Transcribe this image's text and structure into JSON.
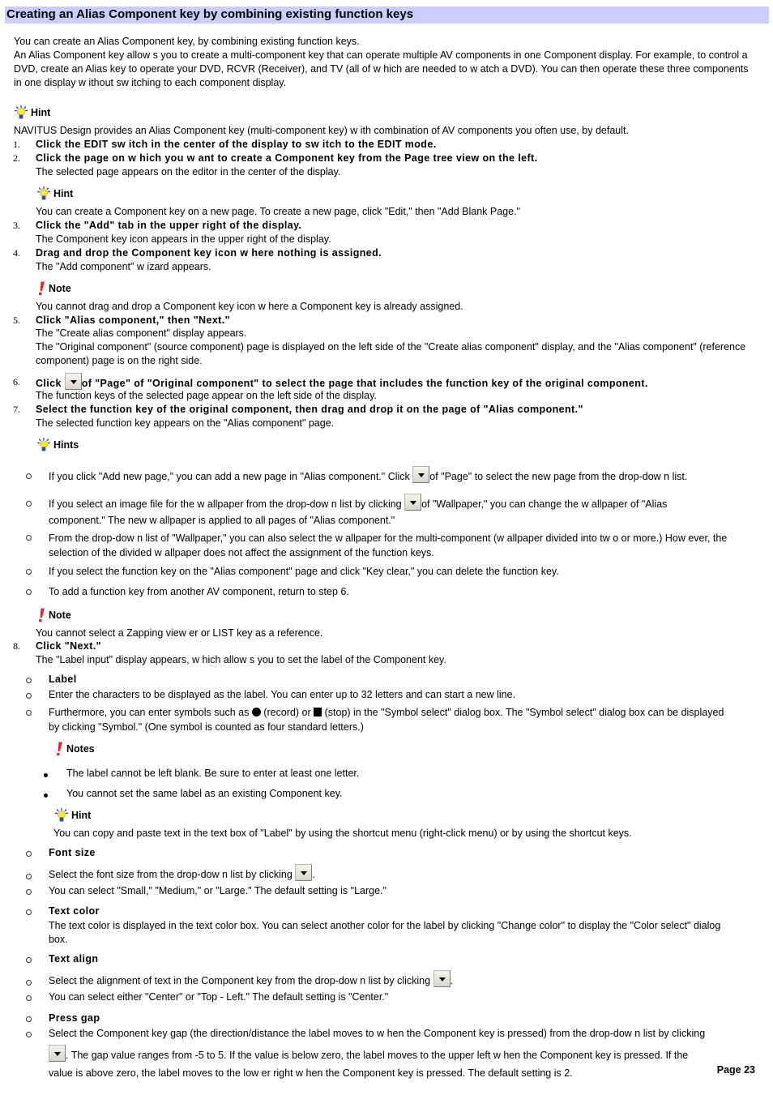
{
  "title": "Creating an Alias Component key by combining existing function keys",
  "intro": [
    "You can create an Alias Component key, by combining existing function keys.",
    "An Alias Component key allow s you to create a multi-component key that can operate multiple AV components in one Component display. For example, to control a DVD, create an Alias key to operate your DVD, RCVR (Receiver), and TV (all of w hich are needed to w atch a DVD). You can then operate these three components in one display w ithout sw itching to each component display."
  ],
  "hint1": {
    "label": "Hint",
    "text": "NAVITUS Design provides an Alias Component key (multi-component key) w ith combination of AV components you often use, by default."
  },
  "steps": [
    {
      "num": "1.",
      "title": "Click the EDIT sw itch in the center of the display to sw itch to the EDIT mode."
    },
    {
      "num": "2.",
      "title": "Click the page on w hich you w ant to create a Component key from the Page tree view on the left.",
      "desc": "The selected page appears on the editor in the center of the display."
    },
    {
      "num": "3.",
      "title": "Click the \"Add\" tab in the upper right of the display.",
      "desc": "The Component key icon appears in the upper right of the display."
    },
    {
      "num": "4.",
      "title": "Drag and drop the Component key icon w here nothing is assigned.",
      "desc": "The \"Add component\" w izard appears."
    },
    {
      "num": "5.",
      "title": "Click \"Alias component,\" then \"Next.\"",
      "desc": "The \"Create alias component\" display appears.",
      "desc2": "The \"Original component\" (source component) page is displayed on the left side of the \"Create alias component\" display, and the \"Alias component\" (reference component) page is on the right side."
    },
    {
      "num": "6.",
      "title_pre": "Click ",
      "title_post": "of \"Page\" of \"Original component\" to select the page that includes the function key of the original component.",
      "desc": "The function keys of the selected page appear on the left side of the display."
    },
    {
      "num": "7.",
      "title": "Select the function key of the original component, then drag and drop it on the page of \"Alias component.\"",
      "desc": "The selected function key appears on the \"Alias component\" page."
    },
    {
      "num": "8.",
      "title": "Click \"Next.\"",
      "desc": "The \"Label input\" display appears, w hich allow s you to set the label of the Component key."
    }
  ],
  "hint2": {
    "label": "Hint",
    "text": "You can create a Component key on a new  page. To create a new  page, click \"Edit,\" then \"Add Blank Page.\""
  },
  "note1": {
    "label": "Note",
    "text": "You cannot drag and drop a Component key icon w here a Component key is already assigned."
  },
  "hints3": {
    "label": "Hints",
    "items": [
      {
        "pre": "If you click \"Add new  page,\" you can add a new  page in \"Alias component.\" Click ",
        "post": "of \"Page\" to select the new  page from the drop-dow n list."
      },
      {
        "pre": "If you select an image file for the w allpaper from the drop-dow n list by clicking ",
        "post": "of \"Wallpaper,\" you can change the w allpaper of \"Alias component.\" The new  w allpaper is applied to all pages of \"Alias component.\""
      },
      {
        "text": "From the drop-dow n list of \"Wallpaper,\" you can also select the w allpaper for the multi-component (w allpaper divided into tw o or more.) How ever, the selection of the divided w allpaper does not affect the assignment of the function keys."
      },
      {
        "text": "If you select the function key on the \"Alias component\" page and click \"Key clear,\" you can delete the function key."
      },
      {
        "text": "To add a function key from another AV component, return to step 6."
      }
    ]
  },
  "note2": {
    "label": "Note",
    "text": "You cannot select a Zapping view er or LIST key as a reference."
  },
  "label_section": {
    "heading": "Label",
    "line1": "Enter the characters to be displayed as the label. You can enter up to 32 letters and can start a new  line.",
    "line2_a": "Furthermore, you can enter symbols such as ",
    "line2_b": "(record) or ",
    "line2_c": "(stop) in the \"Symbol select\" dialog box. The \"Symbol select\" dialog box can be displayed by clicking \"Symbol.\" (One symbol is counted as four standard letters.)",
    "notes_label": "Notes",
    "notes": [
      "The label cannot be left blank. Be sure to enter at least one letter.",
      "You cannot set the same label as an existing Component key."
    ],
    "hint_label": "Hint",
    "hint_text": "You can copy and paste text in the text box of \"Label\" by using the shortcut menu (right-click menu) or by using the shortcut keys."
  },
  "font_size": {
    "heading": "Font size",
    "line1_pre": "Select the font size from the drop-dow n list by clicking ",
    "line1_post": ".",
    "line2": "You can select \"Small,\" \"Medium,\" or \"Large.\" The default setting is \"Large.\""
  },
  "text_color": {
    "heading": "Text color",
    "text": "The text color is displayed in the text color box. You can select another color for the label by clicking \"Change color\" to display the \"Color select\" dialog box."
  },
  "text_align": {
    "heading": "Text align",
    "line1_pre": "Select the alignment of text in the Component key from the drop-dow n list by clicking ",
    "line1_post": ".",
    "line2": "You can select either \"Center\" or \"Top - Left.\" The default setting is \"Center.\""
  },
  "press_gap": {
    "heading": "Press gap",
    "line1": "Select the Component key gap (the direction/distance the label moves to w hen the Component key is pressed) from the drop-dow n list by clicking",
    "line2_post": ". The gap value ranges from -5 to 5. If the value is below  zero, the label moves to the upper left w hen the Component key is pressed. If the value is above zero, the label moves to the low er right w hen the Component key is pressed. The default setting is 2."
  },
  "page_number": "Page 23",
  "colors": {
    "title_bg": "#ccccff",
    "note_icon": "#e8202a",
    "hint_bulb": "#f5e83a",
    "hint_base": "#2c4fa8"
  }
}
